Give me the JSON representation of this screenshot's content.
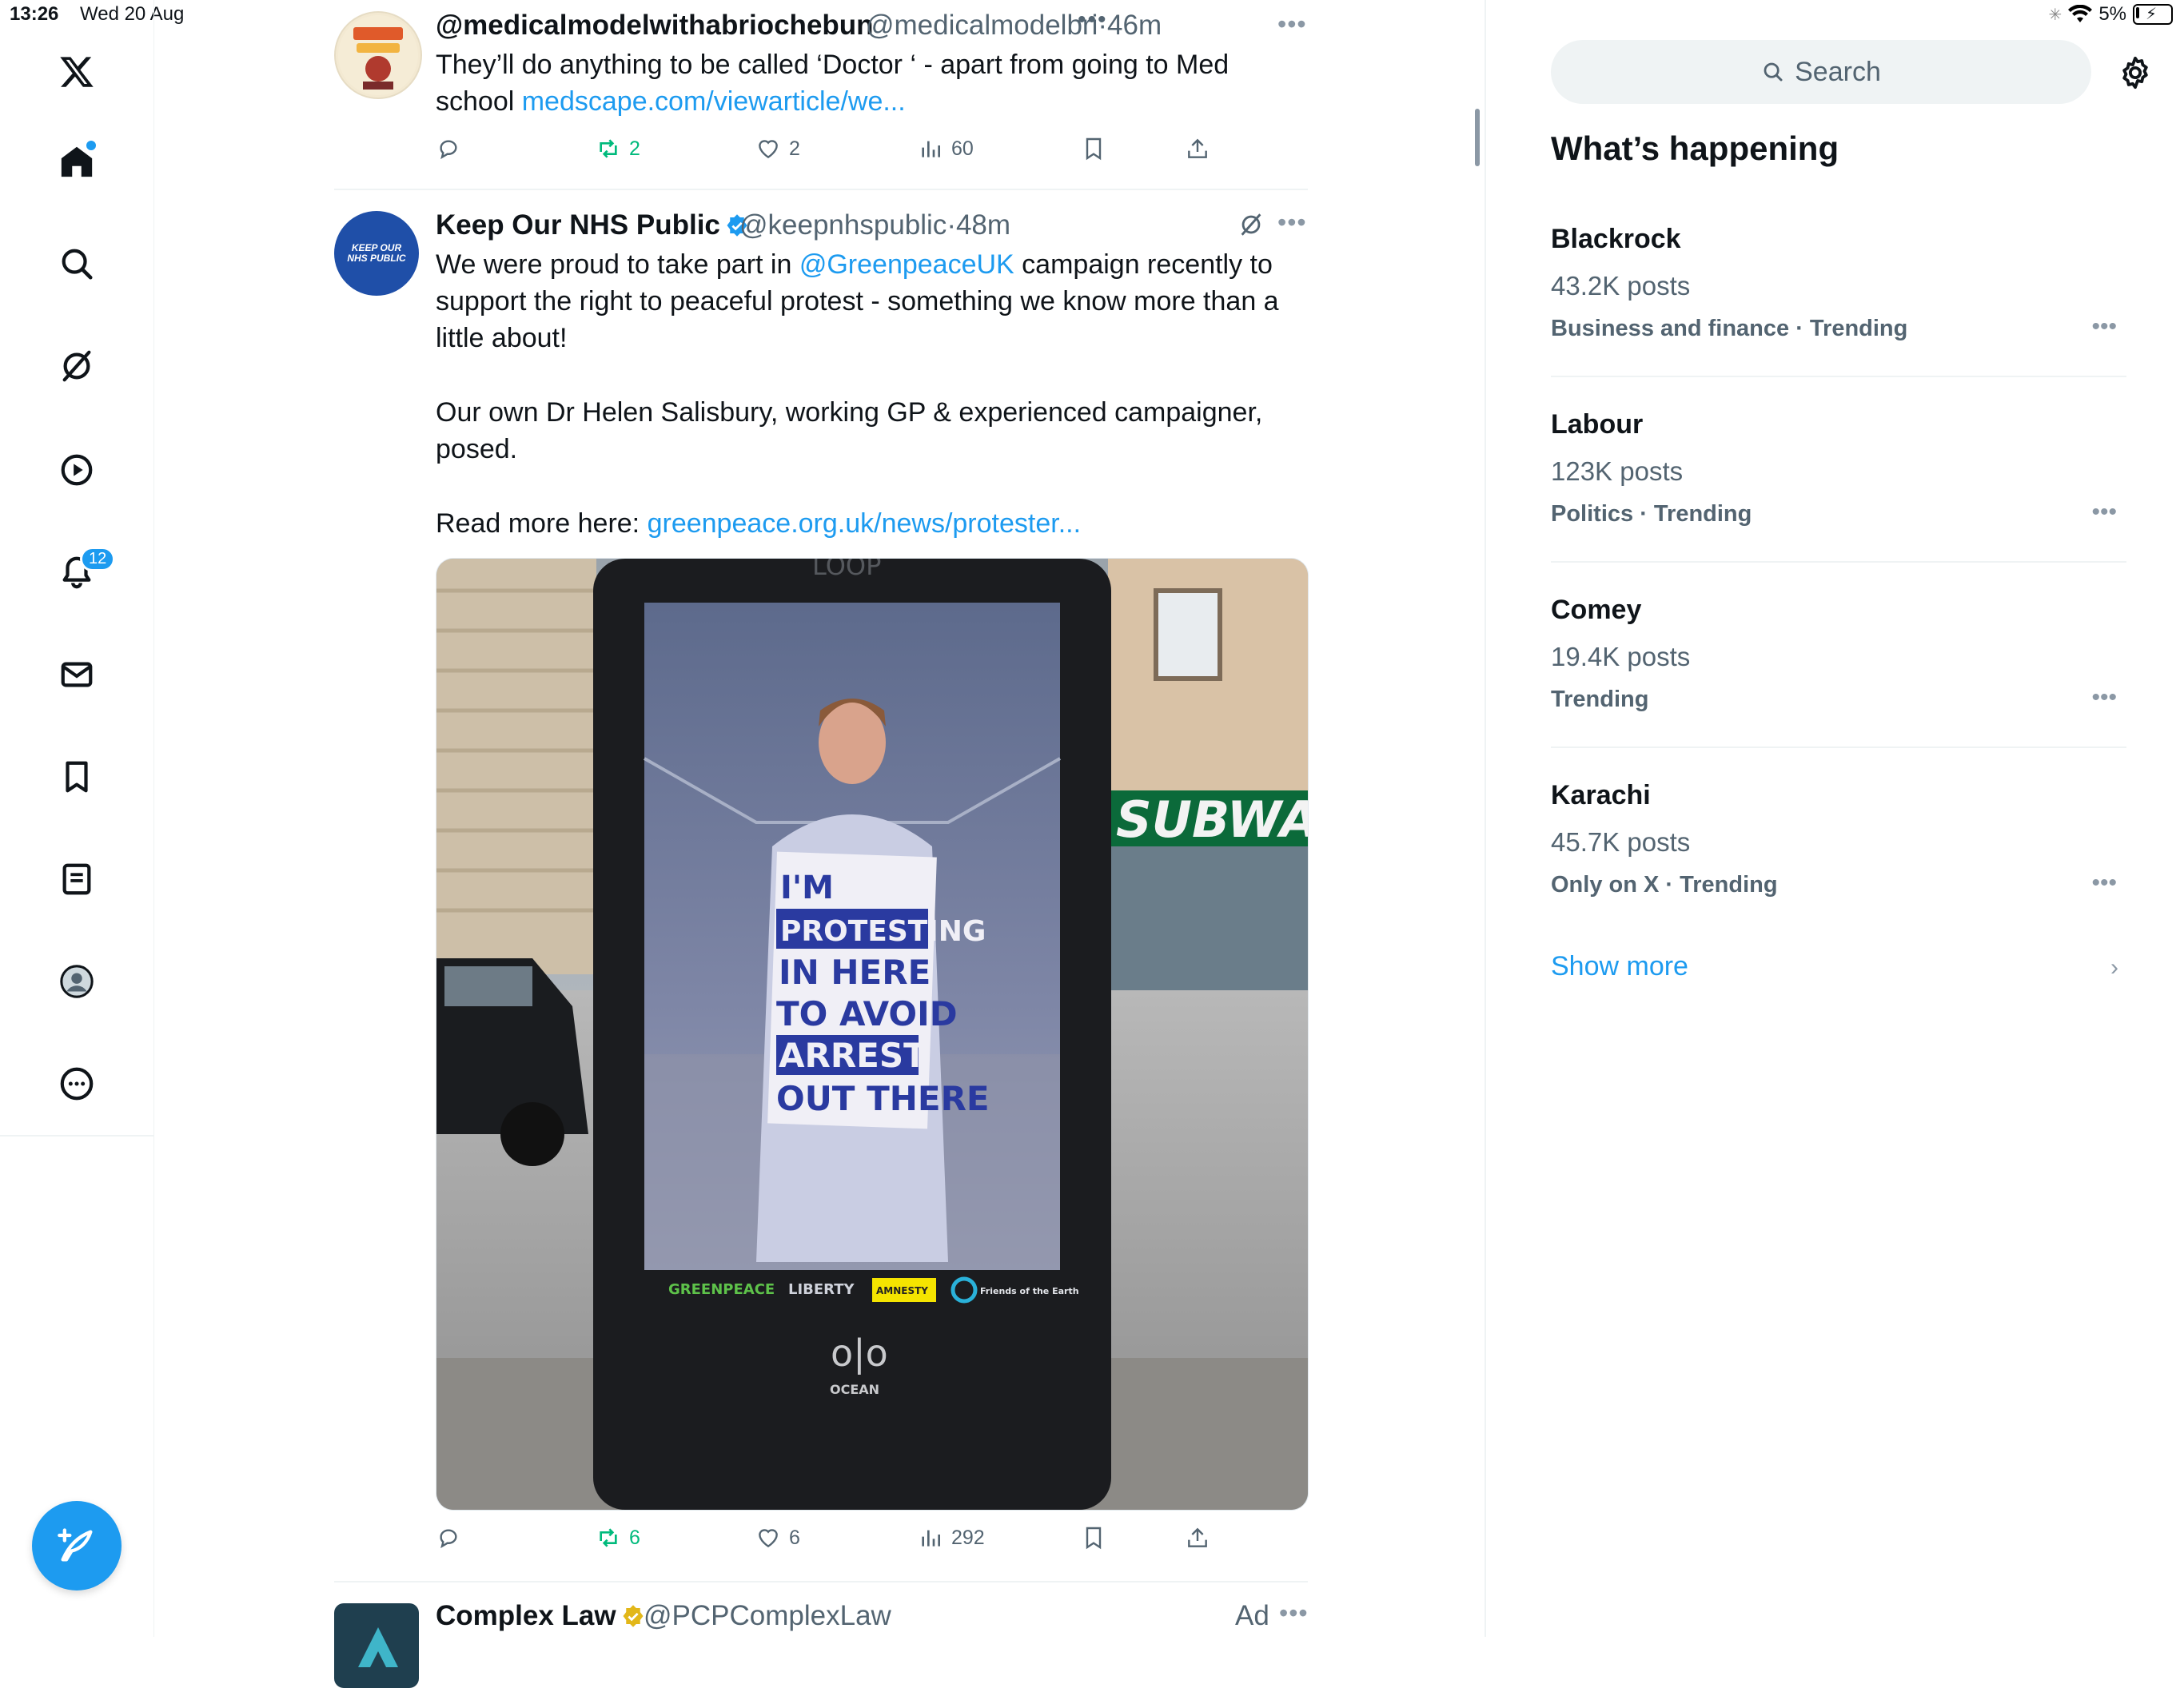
{
  "status_bar": {
    "time": "13:26",
    "date": "Wed 20 Aug",
    "battery": "5%"
  },
  "nav": {
    "items": [
      "x-logo",
      "home",
      "explore",
      "grok",
      "video",
      "notifications",
      "messages",
      "bookmarks",
      "lists",
      "profile",
      "more"
    ],
    "notifications_badge": "12"
  },
  "tweets": [
    {
      "name": "@medicalmodelwithabriochebun",
      "handle": "@medicalmodelbri",
      "time": "·46m",
      "text_1": "They’ll do anything to be called ‘Doctor ‘ - apart from going to Med school ",
      "link": "medscape.com/viewarticle/we...",
      "reposts": "2",
      "likes": "2",
      "views": "60"
    },
    {
      "name": "Keep Our NHS Public",
      "handle": "@keepnhspublic",
      "time": "·48m",
      "avatar_text": "KEEP OUR NHS PUBLIC",
      "text_a": "We were proud to take part in ",
      "mention": "@GreenpeaceUK",
      "text_b": " campaign recently to support the right to peaceful protest - something we know more than a little about!",
      "text_c": "Our own Dr Helen Salisbury, working GP & experienced campaigner, posed.",
      "text_d": "Read more here: ",
      "link": "greenpeace.org.uk/news/protester...",
      "media": {
        "brand_top": "LOOP",
        "sign_lines": [
          "I'M",
          "PROTESTING",
          "IN HERE",
          "TO AVOID",
          "ARREST",
          "OUT THERE"
        ],
        "shop_sign": "SUBWAY",
        "logos": [
          "GREENPEACE",
          "LIBERTY",
          "AMNESTY",
          "Friends of the Earth"
        ],
        "bottom_brand": "OCEAN"
      },
      "reposts": "6",
      "likes": "6",
      "views": "292"
    },
    {
      "name": "Complex Law",
      "handle": "@PCPComplexLaw",
      "ad": "Ad"
    }
  ],
  "sidebar": {
    "search_placeholder": "Search",
    "title": "What’s happening",
    "trends": [
      {
        "name": "Blackrock",
        "count": "43.2K posts",
        "category": "Business and finance · Trending"
      },
      {
        "name": "Labour",
        "count": "123K posts",
        "category": "Politics · Trending"
      },
      {
        "name": "Comey",
        "count": "19.4K posts",
        "category": "Trending"
      },
      {
        "name": "Karachi",
        "count": "45.7K posts",
        "category": "Only on X · Trending"
      }
    ],
    "show_more": "Show more"
  },
  "colors": {
    "accent": "#1d9bf0",
    "repost": "#00ba7c",
    "muted": "#536471"
  }
}
